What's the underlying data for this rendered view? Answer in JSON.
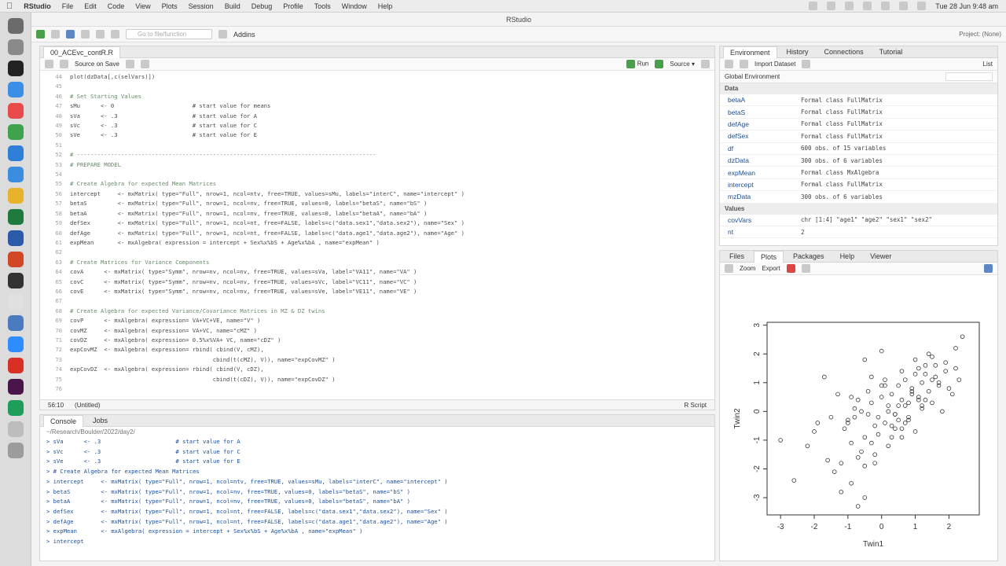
{
  "menubar": {
    "app": "RStudio",
    "items": [
      "File",
      "Edit",
      "Code",
      "View",
      "Plots",
      "Session",
      "Build",
      "Debug",
      "Profile",
      "Tools",
      "Window",
      "Help"
    ],
    "clock": "Tue 28 Jun  9:48 am"
  },
  "window": {
    "title": "RStudio"
  },
  "toolbar": {
    "goto_placeholder": "Go to file/function",
    "addins": "Addins",
    "project": "Project: (None)"
  },
  "editor": {
    "tab": "00_ACEvc_contR.R",
    "source_on_save": "Source on Save",
    "run": "Run",
    "source": "Source",
    "status_pos": "56:10",
    "status_scope": "(Untitled)",
    "status_type": "R Script",
    "lines": [
      {
        "n": "44",
        "t": "plot(dzData[,c(selVars)])"
      },
      {
        "n": "45",
        "t": ""
      },
      {
        "n": "46",
        "t": "# Set Starting Values"
      },
      {
        "n": "47",
        "t": "sMu      <- 0                       # start value for means"
      },
      {
        "n": "48",
        "t": "sVa      <- .3                      # start value for A"
      },
      {
        "n": "49",
        "t": "sVc      <- .3                      # start value for C"
      },
      {
        "n": "50",
        "t": "sVe      <- .3                      # start value for E"
      },
      {
        "n": "51",
        "t": ""
      },
      {
        "n": "52",
        "t": "# ----------------------------------------------------------------------------------------"
      },
      {
        "n": "53",
        "t": "# PREPARE MODEL"
      },
      {
        "n": "54",
        "t": ""
      },
      {
        "n": "55",
        "t": "# Create Algebra for expected Mean Matrices"
      },
      {
        "n": "56",
        "t": "intercept     <- mxMatrix( type=\"Full\", nrow=1, ncol=ntv, free=TRUE, values=sMu, labels=\"interC\", name=\"intercept\" )"
      },
      {
        "n": "57",
        "t": "betaS         <- mxMatrix( type=\"Full\", nrow=1, ncol=nv, free=TRUE, values=0, labels=\"betaS\", name=\"bS\" )"
      },
      {
        "n": "58",
        "t": "betaA         <- mxMatrix( type=\"Full\", nrow=1, ncol=nv, free=TRUE, values=0, labels=\"betaA\", name=\"bA\" )"
      },
      {
        "n": "59",
        "t": "defSex        <- mxMatrix( type=\"Full\", nrow=1, ncol=nt, free=FALSE, labels=c(\"data.sex1\",\"data.sex2\"), name=\"Sex\" )"
      },
      {
        "n": "60",
        "t": "defAge        <- mxMatrix( type=\"Full\", nrow=1, ncol=nt, free=FALSE, labels=c(\"data.age1\",\"data.age2\"), name=\"Age\" )"
      },
      {
        "n": "61",
        "t": "expMean       <- mxAlgebra( expression = intercept + Sex%x%bS + Age%x%bA , name=\"expMean\" )"
      },
      {
        "n": "62",
        "t": ""
      },
      {
        "n": "63",
        "t": "# Create Matrices for Variance Components"
      },
      {
        "n": "64",
        "t": "covA      <- mxMatrix( type=\"Symm\", nrow=nv, ncol=nv, free=TRUE, values=sVa, label=\"VA11\", name=\"VA\" )"
      },
      {
        "n": "65",
        "t": "covC      <- mxMatrix( type=\"Symm\", nrow=nv, ncol=nv, free=TRUE, values=sVc, label=\"VC11\", name=\"VC\" )"
      },
      {
        "n": "66",
        "t": "covE      <- mxMatrix( type=\"Symm\", nrow=nv, ncol=nv, free=TRUE, values=sVe, label=\"VE11\", name=\"VE\" )"
      },
      {
        "n": "67",
        "t": ""
      },
      {
        "n": "68",
        "t": "# Create Algebra for expected Variance/Covariance Matrices in MZ & DZ twins"
      },
      {
        "n": "69",
        "t": "covP      <- mxAlgebra( expression= VA+VC+VE, name=\"V\" )"
      },
      {
        "n": "70",
        "t": "covMZ     <- mxAlgebra( expression= VA+VC, name=\"cMZ\" )"
      },
      {
        "n": "71",
        "t": "covDZ     <- mxAlgebra( expression= 0.5%x%VA+ VC, name=\"cDZ\" )"
      },
      {
        "n": "72",
        "t": "expCovMZ  <- mxAlgebra( expression= rbind( cbind(V, cMZ),"
      },
      {
        "n": "73",
        "t": "                                          cbind(t(cMZ), V)), name=\"expCovMZ\" )"
      },
      {
        "n": "74",
        "t": "expCovDZ  <- mxAlgebra( expression= rbind( cbind(V, cDZ),"
      },
      {
        "n": "75",
        "t": "                                          cbind(t(cDZ), V)), name=\"expCovDZ\" )"
      },
      {
        "n": "76",
        "t": ""
      }
    ]
  },
  "console": {
    "tabs": [
      "Console",
      "Jobs"
    ],
    "path": "~/Research/Boulder/2022/day2/",
    "lines": [
      "> sVa      <- .3                      # start value for A",
      "> sVc      <- .3                      # start value for C",
      "> sVe      <- .3                      # start value for E",
      "> # Create Algebra for expected Mean Matrices",
      "> intercept     <- mxMatrix( type=\"Full\", nrow=1, ncol=ntv, free=TRUE, values=sMu, labels=\"interC\", name=\"intercept\" )",
      "> betaS         <- mxMatrix( type=\"Full\", nrow=1, ncol=nv, free=TRUE, values=0, labels=\"betaS\", name=\"bS\" )",
      "> betaA         <- mxMatrix( type=\"Full\", nrow=1, ncol=nv, free=TRUE, values=0, labels=\"betaS\", name=\"bA\" )",
      "> defSex        <- mxMatrix( type=\"Full\", nrow=1, ncol=nt, free=FALSE, labels=c(\"data.sex1\",\"data.sex2\"), name=\"Sex\" )",
      "> defAge        <- mxMatrix( type=\"Full\", nrow=1, ncol=nt, free=FALSE, labels=c(\"data.age1\",\"data.age2\"), name=\"Age\" )",
      "> expMean       <- mxAlgebra( expression = intercept + Sex%x%bS + Age%x%bA , name=\"expMean\" )",
      "> intercept"
    ]
  },
  "environment": {
    "tabs": [
      "Environment",
      "History",
      "Connections",
      "Tutorial"
    ],
    "import": "Import Dataset",
    "scope": "Global Environment",
    "list_mode": "List",
    "data_header": "Data",
    "values_header": "Values",
    "data": [
      {
        "name": "betaA",
        "value": "Formal class FullMatrix"
      },
      {
        "name": "betaS",
        "value": "Formal class FullMatrix"
      },
      {
        "name": "defAge",
        "value": "Formal class FullMatrix"
      },
      {
        "name": "defSex",
        "value": "Formal class FullMatrix"
      },
      {
        "name": "df",
        "value": "600 obs. of 15 variables"
      },
      {
        "name": "dzData",
        "value": "300 obs. of 6 variables"
      },
      {
        "name": "expMean",
        "value": "Formal class MxAlgebra"
      },
      {
        "name": "intercept",
        "value": "Formal class FullMatrix"
      },
      {
        "name": "mzData",
        "value": "300 obs. of 6 variables"
      }
    ],
    "values": [
      {
        "name": "covVars",
        "value": "chr [1:4] \"age1\" \"age2\" \"sex1\" \"sex2\""
      },
      {
        "name": "nt",
        "value": "2"
      }
    ]
  },
  "plots": {
    "tabs": [
      "Files",
      "Plots",
      "Packages",
      "Help",
      "Viewer"
    ],
    "zoom": "Zoom",
    "export": "Export"
  },
  "chart_data": {
    "type": "scatter",
    "xlabel": "Twin1",
    "ylabel": "Twin2",
    "xlim": [
      -3.4,
      2.9
    ],
    "ylim": [
      -3.6,
      3.1
    ],
    "xticks": [
      -3,
      -2,
      -1,
      0,
      1,
      2
    ],
    "yticks": [
      -3,
      -2,
      -1,
      0,
      1,
      2,
      3
    ],
    "x": [
      -3.0,
      -2.0,
      -1.9,
      -1.5,
      -1.3,
      -1.2,
      -1.1,
      -1.0,
      -0.9,
      -0.8,
      -0.7,
      -0.6,
      -0.5,
      -0.4,
      -0.3,
      -0.2,
      -0.1,
      0.0,
      0.1,
      0.2,
      0.3,
      0.4,
      0.5,
      0.6,
      0.7,
      0.8,
      0.9,
      1.0,
      1.1,
      1.2,
      1.3,
      1.4,
      1.5,
      1.6,
      1.7,
      1.9,
      2.1,
      2.2,
      2.3,
      2.4,
      -2.6,
      -2.2,
      -1.6,
      -1.4,
      -0.9,
      -0.6,
      -0.5,
      -0.3,
      -0.1,
      0.2,
      0.4,
      0.6,
      0.8,
      1.0,
      1.2,
      1.5,
      1.8,
      -1.2,
      -0.8,
      -0.2,
      0.0,
      0.3,
      0.5,
      0.7,
      0.9,
      1.1,
      1.3,
      1.6,
      2.0,
      -0.4,
      0.1,
      0.6,
      1.0,
      1.4,
      -1.0,
      -0.7,
      -0.3,
      0.2,
      0.8,
      1.7,
      -0.7,
      -0.5,
      0.4,
      1.1,
      0.0,
      0.5,
      0.9,
      1.2,
      -0.5,
      -0.2,
      0.3,
      0.7,
      1.5,
      1.9,
      -1.7,
      -0.9,
      0.1,
      0.6,
      1.3,
      2.2
    ],
    "y": [
      -1.0,
      -0.7,
      -0.4,
      -0.2,
      0.6,
      -1.8,
      -0.6,
      -0.3,
      -1.1,
      0.1,
      0.4,
      0.0,
      -0.9,
      -0.1,
      0.3,
      -0.5,
      -0.2,
      0.5,
      -0.4,
      0.2,
      0.6,
      -0.1,
      0.9,
      0.4,
      1.1,
      0.3,
      0.8,
      1.3,
      0.5,
      1.0,
      1.6,
      0.7,
      1.9,
      1.2,
      0.9,
      1.4,
      0.6,
      2.2,
      1.1,
      2.6,
      -2.4,
      -1.2,
      -1.7,
      -2.1,
      -2.5,
      -1.4,
      -1.9,
      -1.1,
      -0.8,
      -1.2,
      -0.6,
      -0.9,
      -0.3,
      -0.7,
      0.1,
      0.3,
      0.0,
      -2.8,
      -0.2,
      -1.5,
      0.9,
      -0.9,
      0.2,
      -0.4,
      0.7,
      0.4,
      1.3,
      1.6,
      0.8,
      0.7,
      1.1,
      1.4,
      1.8,
      2.0,
      -0.4,
      -1.6,
      1.2,
      0.0,
      -0.2,
      1.0,
      -3.3,
      1.8,
      -0.1,
      1.5,
      2.1,
      -0.3,
      0.6,
      0.2,
      -3.0,
      -1.8,
      -0.5,
      0.2,
      1.1,
      1.7,
      1.2,
      0.5,
      0.9,
      -0.6,
      0.4,
      1.5
    ],
    "grid": false
  }
}
